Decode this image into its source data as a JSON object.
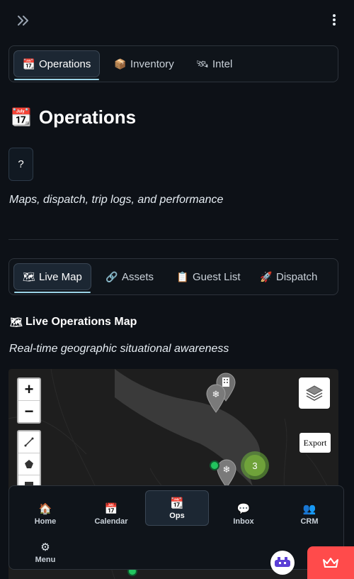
{
  "header": {
    "expand_icon": "double-chevron-right-icon",
    "menu_icon": "vertical-ellipsis-icon"
  },
  "main_tabs": [
    {
      "label": "Operations",
      "icon": "calendar-icon",
      "active": true
    },
    {
      "label": "Inventory",
      "icon": "package-icon",
      "active": false
    },
    {
      "label": "Intel",
      "icon": "satellite-icon",
      "active": false
    }
  ],
  "page": {
    "title": "Operations",
    "help_label": "?",
    "subtitle": "Maps, dispatch, trip logs, and performance"
  },
  "sub_tabs": [
    {
      "label": "Live Map",
      "icon": "map-icon",
      "active": true
    },
    {
      "label": "Assets",
      "icon": "link-icon",
      "active": false
    },
    {
      "label": "Guest List",
      "icon": "clipboard-icon",
      "active": false
    },
    {
      "label": "Dispatch",
      "icon": "rocket-icon",
      "active": false
    }
  ],
  "section": {
    "title": "Live Operations Map",
    "subtitle": "Real-time geographic situational awareness"
  },
  "map": {
    "zoom_in": "+",
    "zoom_out": "−",
    "export_label": "Export",
    "cluster_count": "3"
  },
  "bottom_nav": [
    {
      "label": "Home",
      "icon": "house-icon",
      "active": false
    },
    {
      "label": "Calendar",
      "icon": "calendar-icon",
      "active": false
    },
    {
      "label": "Ops",
      "icon": "calendar-icon",
      "active": true
    },
    {
      "label": "Inbox",
      "icon": "speech-bubble-icon",
      "active": false
    },
    {
      "label": "CRM",
      "icon": "people-icon",
      "active": false
    },
    {
      "label": "Menu",
      "icon": "gear-icon",
      "active": false
    }
  ],
  "colors": {
    "background": "#0d1117",
    "accent_underline": "#9bd3e6",
    "cluster_green": "#6fa23a",
    "deploy_red": "#ff4b4b"
  }
}
